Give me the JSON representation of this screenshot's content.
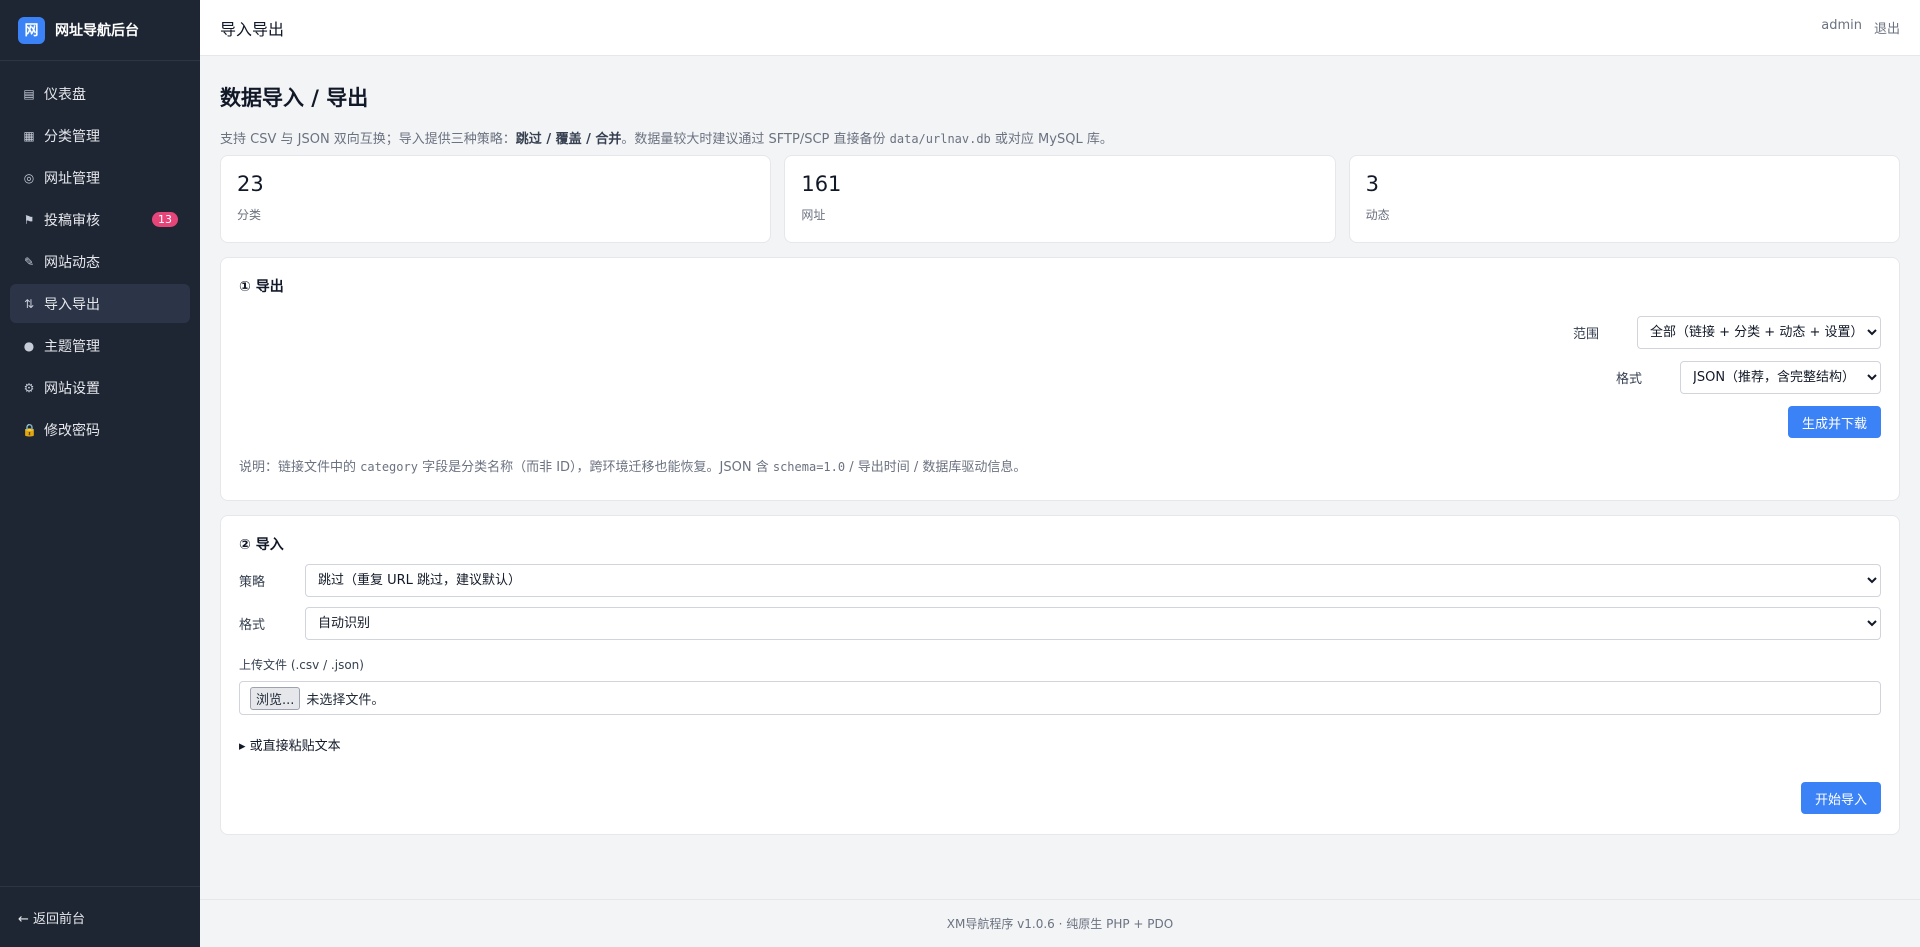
{
  "brand": {
    "logo": "网",
    "title": "网址导航后台"
  },
  "nav": [
    {
      "icon": "▤",
      "icon_name": "dashboard-icon",
      "label": "仪表盘"
    },
    {
      "icon": "▦",
      "icon_name": "category-grid-icon",
      "label": "分类管理"
    },
    {
      "icon": "◎",
      "icon_name": "link-icon",
      "label": "网址管理"
    },
    {
      "icon": "⚑",
      "icon_name": "flag-icon",
      "label": "投稿审核",
      "badge": "13"
    },
    {
      "icon": "✎",
      "icon_name": "pen-icon",
      "label": "网站动态"
    },
    {
      "icon": "⇅",
      "icon_name": "import-export-icon",
      "label": "导入导出",
      "active": true
    },
    {
      "icon": "●",
      "icon_name": "palette-icon",
      "label": "主题管理"
    },
    {
      "icon": "⚙",
      "icon_name": "gear-icon",
      "label": "网站设置"
    },
    {
      "icon": "🔒",
      "icon_name": "lock-icon",
      "label": "修改密码"
    }
  ],
  "sidebar_footer": "← 返回前台",
  "topbar": {
    "title": "导入导出",
    "user": "admin",
    "logout": "退出"
  },
  "page": {
    "title": "数据导入 / 导出",
    "desc_pre": "支持 CSV 与 JSON 双向互换；导入提供三种策略：",
    "desc_strategies": "跳过 / 覆盖 / 合并",
    "desc_mid": "。数据量较大时建议通过 SFTP/SCP 直接备份 ",
    "desc_path": "data/urlnav.db",
    "desc_post": " 或对应 MySQL 库。"
  },
  "stats": [
    {
      "value": "23",
      "label": "分类"
    },
    {
      "value": "161",
      "label": "网址"
    },
    {
      "value": "3",
      "label": "动态"
    }
  ],
  "export": {
    "title": "① 导出",
    "scope_label": "范围",
    "scope_value": "全部（链接 + 分类 + 动态 + 设置）",
    "format_label": "格式",
    "format_value": "JSON（推荐，含完整结构）",
    "button": "生成并下载",
    "note_pre": "说明：链接文件中的 ",
    "note_code1": "category",
    "note_mid": " 字段是分类名称（而非 ID），跨环境迁移也能恢复。JSON 含 ",
    "note_code2": "schema=1.0",
    "note_post": " / 导出时间 / 数据库驱动信息。"
  },
  "import": {
    "title": "② 导入",
    "strategy_label": "策略",
    "strategy_value": "跳过（重复 URL 跳过，建议默认）",
    "format_label": "格式",
    "format_value": "自动识别",
    "upload_label": "上传文件 (.csv / .json)",
    "browse_button": "浏览...",
    "no_file": "未选择文件。",
    "paste_toggle": "▸ 或直接粘贴文本",
    "button": "开始导入"
  },
  "footer": "XM导航程序 v1.0.6 · 纯原生 PHP + PDO"
}
